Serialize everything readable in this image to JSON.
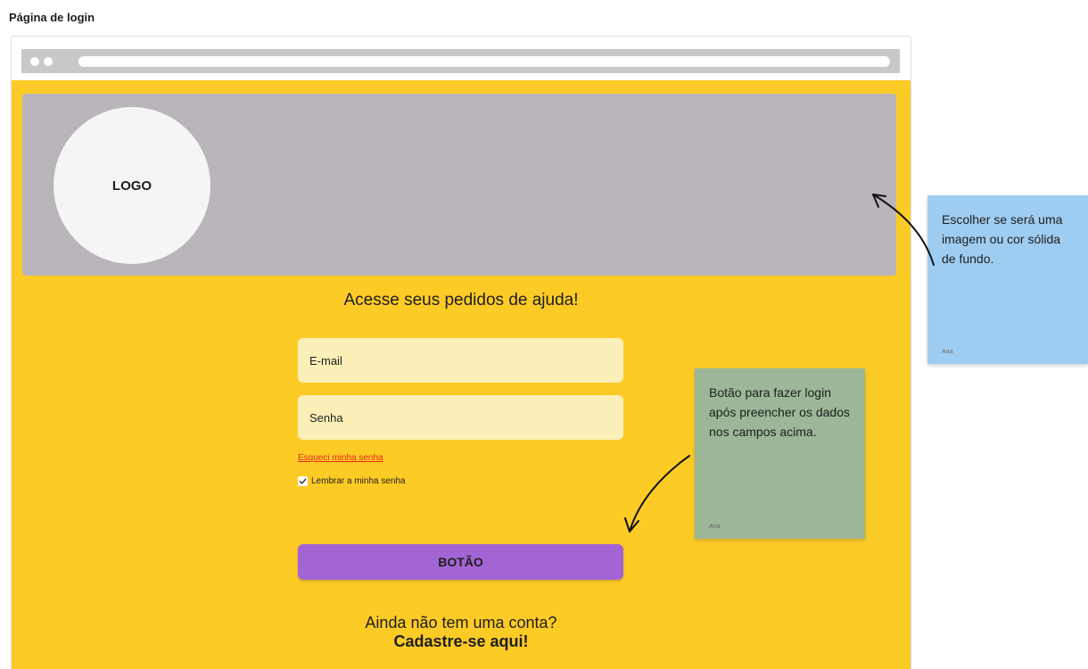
{
  "frame": {
    "title": "Página de login"
  },
  "login": {
    "logo_text": "LOGO",
    "headline": "Acesse seus pedidos de ajuda!",
    "email_placeholder": "E-mail",
    "password_placeholder": "Senha",
    "forgot_link": "Esqueci minha senha",
    "remember_label": "Lembrar a minha senha",
    "remember_checked": true,
    "button_label": "BOTÃO",
    "signup_question": "Ainda não tem uma conta?",
    "signup_link": "Cadastre-se aqui!"
  },
  "notes": [
    {
      "text": "Botão para fazer login após preencher os dados nos campos acima.",
      "author": "Ana",
      "color": "#9bb797"
    },
    {
      "text": "Escolher se será uma imagem ou cor sólida de fundo.",
      "author": "Ana",
      "color": "#9fcdf2"
    }
  ],
  "colors": {
    "page_background": "#fdcb26",
    "hero_background": "#b9b5bb",
    "input_background": "#fdefb8",
    "button_background": "#a465d4",
    "link_color": "#e8281e"
  }
}
